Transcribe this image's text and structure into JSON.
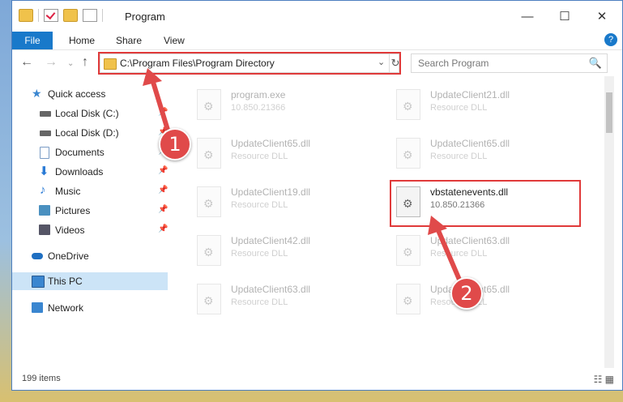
{
  "window": {
    "title": "Program",
    "minimize": "—",
    "maximize": "☐",
    "close": "✕"
  },
  "ribbon": {
    "tabs": [
      "File",
      "Home",
      "Share",
      "View"
    ],
    "help": "?"
  },
  "nav": {
    "back": "←",
    "forward": "→",
    "up": "↑",
    "address": "C:\\Program Files\\Program Directory",
    "refresh": "↻",
    "dropdown": "⌄",
    "search_placeholder": "Search Program",
    "search_icon": "🔍"
  },
  "sidebar": {
    "items": [
      {
        "label": "Quick access",
        "icon": "star-icon",
        "color": "#3a86d0"
      },
      {
        "label": "Local Disk (C:)",
        "icon": "drive-icon",
        "color": "#666666"
      },
      {
        "label": "Local Disk (D:)",
        "icon": "drive-icon",
        "color": "#666666"
      },
      {
        "label": "Documents",
        "icon": "document-icon",
        "color": "#7a9cc5"
      },
      {
        "label": "Downloads",
        "icon": "download-icon",
        "color": "#2b7bd6"
      },
      {
        "label": "Music",
        "icon": "music-icon",
        "color": "#2b7bd6"
      },
      {
        "label": "Pictures",
        "icon": "pictures-icon",
        "color": "#4a90c0"
      },
      {
        "label": "Videos",
        "icon": "video-icon",
        "color": "#556"
      },
      {
        "label": "OneDrive",
        "icon": "cloud-icon",
        "color": "#1f6fc2"
      },
      {
        "label": "This PC",
        "icon": "computer-icon",
        "color": "#3a86d0"
      },
      {
        "label": "Network",
        "icon": "network-icon",
        "color": "#3a86d0"
      }
    ]
  },
  "files": [
    {
      "name": "program.exe",
      "sub": "10.850.21366"
    },
    {
      "name": "UpdateClient21.dll",
      "sub": "Resource DLL"
    },
    {
      "name": "UpdateClient65.dll",
      "sub": "Resource DLL"
    },
    {
      "name": "UpdateClient65.dll",
      "sub": "Resource DLL"
    },
    {
      "name": "UpdateClient19.dll",
      "sub": "Resource DLL"
    },
    {
      "name": "vbstatenevents.dll",
      "sub": "10.850.21366"
    },
    {
      "name": "UpdateClient42.dll",
      "sub": "Resource DLL"
    },
    {
      "name": "UpdateClient63.dll",
      "sub": "Resource DLL"
    },
    {
      "name": "UpdateClient63.dll",
      "sub": "Resource DLL"
    },
    {
      "name": "UpdateClient65.dll",
      "sub": "Resource DLL"
    }
  ],
  "status": {
    "count": "199 items",
    "view_icons": "☷ ▦"
  },
  "markers": [
    "1",
    "2"
  ],
  "accent_color": "#e03a3a"
}
